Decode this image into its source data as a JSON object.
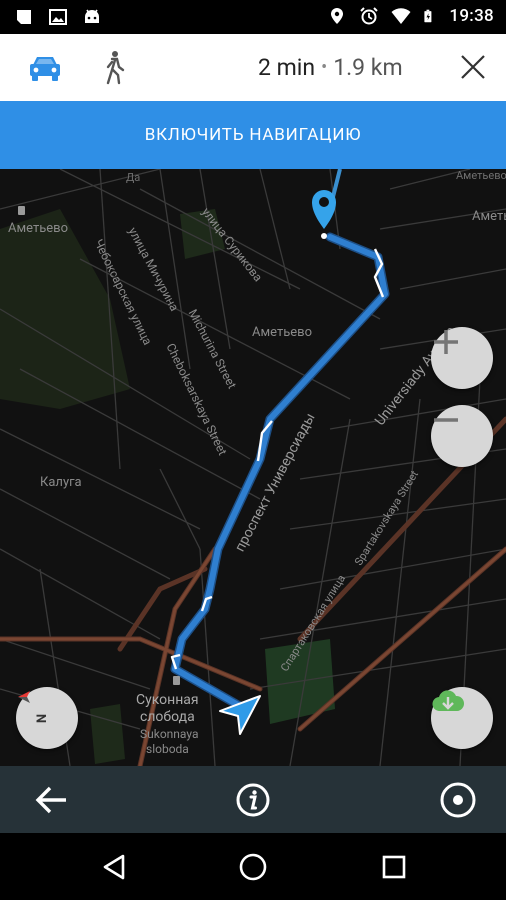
{
  "status_bar": {
    "time": "19:38",
    "left_icons": [
      "notes-icon",
      "gallery-icon",
      "android-icon"
    ],
    "right_icons": [
      "location-icon",
      "alarm-icon",
      "wifi-icon",
      "battery-charging-icon"
    ]
  },
  "header": {
    "modes": [
      {
        "name": "car-mode",
        "icon": "car-icon",
        "active": true
      },
      {
        "name": "walk-mode",
        "icon": "walk-icon",
        "active": false
      }
    ],
    "time": "2 min",
    "separator": "•",
    "distance": "1.9 km",
    "close_icon": "close-icon"
  },
  "start_navigation_label": "ВКЛЮЧИТЬ НАВИГАЦИЮ",
  "map": {
    "labels": {
      "ametevo_station": "Аметьево",
      "ametevo_district": "Аметьево",
      "ametevo_top_right": "Аметьево",
      "ametevo_right": "Аметь",
      "surikova": "улица Сурикова",
      "minurina": "улица Мичурина",
      "michurina_en": "Michurina Street",
      "cheboksarskaya": "Чебоксарская улица",
      "cheboksarskaya_en": "Cheboksarskaya Street",
      "universitetskiy": "проспект Универсиады",
      "university_en": "Universiady Avenue",
      "spartakovskaya": "Спартаковская улица",
      "spartakovskaya_en": "Spartakovskaya Street",
      "kaluga": "Калуга",
      "sukonnaya_ru_1": "Суконная",
      "sukonnaya_ru_2": "слобода",
      "sukonnaya_en_1": "Sukonnaya",
      "sukonnaya_en_2": "sloboda",
      "top_fragment": "Да"
    },
    "colors": {
      "route": "#2f7fd0",
      "route_outline": "#1d4f86",
      "destination_pin": "#35a3ea",
      "position_arrow": "#2f9be8",
      "road_major": "#6b3d2e",
      "park": "#1e2a1a"
    }
  },
  "controls": {
    "zoom_in_icon": "plus-icon",
    "zoom_out_icon": "minus-icon",
    "compass_icon": "compass-icon",
    "compass_letter": "N",
    "download_icon": "cloud-download-icon"
  },
  "toolbar": {
    "back_icon": "arrow-back-icon",
    "info_icon": "info-icon",
    "locate_icon": "my-location-icon"
  },
  "nav_bar": {
    "back": "nav-back-icon",
    "home": "nav-home-icon",
    "recents": "nav-recents-icon"
  }
}
